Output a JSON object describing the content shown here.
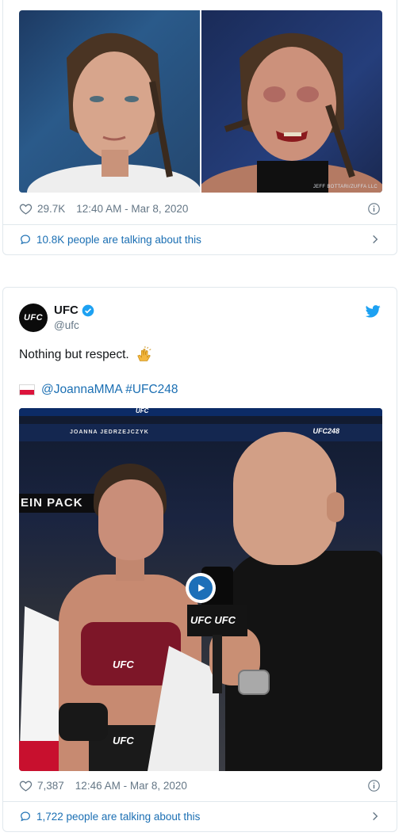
{
  "tweet1": {
    "photo_credit": "JEFF BOTTARI/ZUFFA LLC",
    "likes": "29.7K",
    "timestamp": "12:40 AM - Mar 8, 2020",
    "talking": "10.8K people are talking about this"
  },
  "tweet2": {
    "author_name": "UFC",
    "author_handle": "@ufc",
    "avatar_text": "UFC",
    "text": "Nothing but respect.",
    "mentions": "@JoannaMMA #UFC248",
    "video": {
      "banner_top": "UFC",
      "lower_third_name": "JOANNA JEDRZEJCZYK",
      "banner_brand": "UFC248",
      "ad_text": "EIN PACK",
      "bra_logo": "UFC",
      "shorts_logo": "UFC",
      "mic_logo": "UFC UFC"
    },
    "likes": "7,387",
    "timestamp": "12:46 AM - Mar 8, 2020",
    "talking": "1,722 people are talking about this"
  },
  "colors": {
    "link": "#1b6fb3",
    "twitter_blue": "#1da1f2",
    "muted": "#657786",
    "border": "#e1e8ed"
  },
  "icons": [
    "heart-icon",
    "info-icon",
    "comment-bubble-icon",
    "chevron-right-icon",
    "verified-icon",
    "twitter-bird-icon",
    "clapping-hands-icon",
    "poland-flag-icon",
    "play-icon"
  ]
}
